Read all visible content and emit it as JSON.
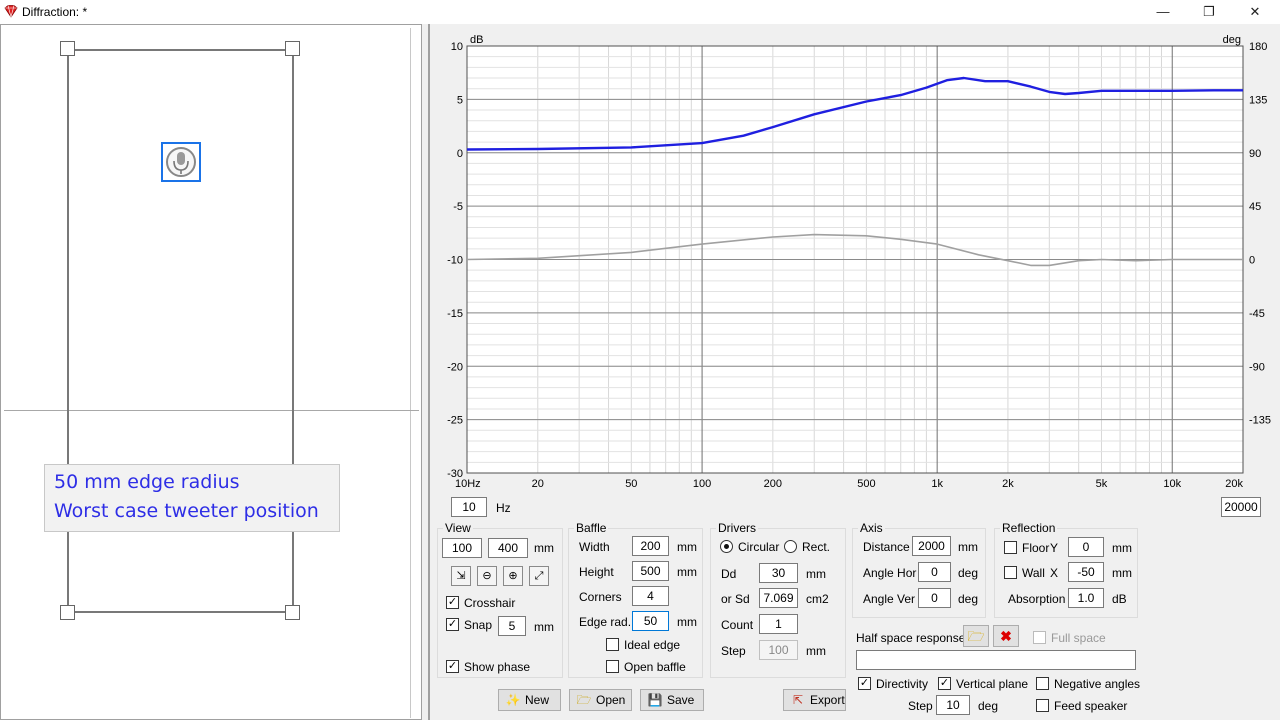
{
  "window": {
    "title": "Diffraction: *",
    "minimize": "—",
    "restore": "❐",
    "close": "✕"
  },
  "callout": {
    "line1": "50 mm edge radius",
    "line2": "Worst case tweeter position"
  },
  "chart_data": {
    "type": "line",
    "xscale": "log",
    "xlim": [
      10,
      20000
    ],
    "ylim": [
      -30,
      10
    ],
    "y2lim": [
      -180,
      180
    ],
    "left_unit": "dB",
    "right_unit": "deg",
    "x_tick_labels": [
      "10Hz",
      "20",
      "50",
      "100",
      "200",
      "500",
      "1k",
      "2k",
      "5k",
      "10k",
      "20k"
    ],
    "x_tick_values": [
      10,
      20,
      50,
      100,
      200,
      500,
      1000,
      2000,
      5000,
      10000,
      20000
    ],
    "y_ticks": [
      10,
      5,
      0,
      -5,
      -10,
      -15,
      -20,
      -25,
      -30
    ],
    "y2_ticks": [
      180,
      135,
      90,
      45,
      0,
      -45,
      -90,
      -135
    ],
    "grid": true,
    "series": [
      {
        "axis": "left",
        "color": "#1f1fe0",
        "x": [
          10,
          20,
          50,
          100,
          150,
          200,
          300,
          500,
          700,
          900,
          1100,
          1300,
          1600,
          2000,
          2500,
          3000,
          3500,
          4000,
          5000,
          6000,
          8000,
          10000,
          15000,
          20000
        ],
        "y": [
          0.3,
          0.35,
          0.5,
          0.9,
          1.6,
          2.4,
          3.6,
          4.8,
          5.4,
          6.1,
          6.8,
          7.0,
          6.7,
          6.7,
          6.2,
          5.7,
          5.5,
          5.6,
          5.8,
          5.8,
          5.8,
          5.8,
          5.85,
          5.85
        ]
      },
      {
        "axis": "right",
        "color": "#a0a0a0",
        "x": [
          10,
          20,
          50,
          100,
          200,
          300,
          500,
          700,
          1000,
          1500,
          2000,
          2500,
          3000,
          4000,
          5000,
          7000,
          10000,
          20000
        ],
        "y": [
          0,
          1,
          6,
          13,
          19,
          21,
          20,
          17,
          13,
          4,
          -1,
          -5,
          -5,
          -1,
          0,
          -1,
          0,
          0
        ]
      }
    ]
  },
  "freq_range": {
    "min": "10",
    "unit": "Hz",
    "max": "20000"
  },
  "view": {
    "title": "View",
    "zoom_min": "100",
    "zoom_max": "400",
    "unit": "mm",
    "crosshair_label": "Crosshair",
    "crosshair_checked": true,
    "snap_label": "Snap",
    "snap_checked": true,
    "snap_value": "5",
    "snap_unit": "mm",
    "show_phase_label": "Show phase",
    "show_phase_checked": true
  },
  "baffle": {
    "title": "Baffle",
    "width_label": "Width",
    "width": "200",
    "width_unit": "mm",
    "height_label": "Height",
    "height": "500",
    "height_unit": "mm",
    "corners_label": "Corners",
    "corners": "4",
    "edge_rad_label": "Edge rad.",
    "edge_rad": "50",
    "edge_rad_unit": "mm",
    "ideal_edge_label": "Ideal edge",
    "ideal_edge_checked": false,
    "open_baffle_label": "Open baffle",
    "open_baffle_checked": false
  },
  "drivers": {
    "title": "Drivers",
    "circular_label": "Circular",
    "circular_selected": true,
    "rect_label": "Rect.",
    "dd_label": "Dd",
    "dd": "30",
    "dd_unit": "mm",
    "sd_label": "or Sd",
    "sd": "7.069",
    "sd_unit": "cm2",
    "count_label": "Count",
    "count": "1",
    "step_label": "Step",
    "step": "100",
    "step_unit": "mm"
  },
  "axis": {
    "title": "Axis",
    "distance_label": "Distance",
    "distance": "2000",
    "distance_unit": "mm",
    "angle_hor_label": "Angle Hor",
    "angle_hor": "0",
    "angle_hor_unit": "deg",
    "angle_ver_label": "Angle Ver",
    "angle_ver": "0",
    "angle_ver_unit": "deg"
  },
  "reflection": {
    "title": "Reflection",
    "floor_label": "Floor",
    "floor_axis": "Y",
    "floor_value": "0",
    "floor_unit": "mm",
    "floor_checked": false,
    "wall_label": "Wall",
    "wall_axis": "X",
    "wall_value": "-50",
    "wall_unit": "mm",
    "wall_checked": false,
    "absorption_label": "Absorption",
    "absorption": "1.0",
    "absorption_unit": "dB"
  },
  "half_space": {
    "label": "Half space response",
    "full_space_label": "Full space",
    "full_space_checked": false,
    "file": ""
  },
  "options": {
    "directivity_label": "Directivity",
    "directivity_checked": true,
    "vertical_plane_label": "Vertical plane",
    "vertical_plane_checked": true,
    "negative_angles_label": "Negative angles",
    "negative_angles_checked": false,
    "feed_speaker_label": "Feed speaker",
    "feed_speaker_checked": false,
    "step_label": "Step",
    "step": "10",
    "step_unit": "deg"
  },
  "buttons": {
    "new": "New",
    "open": "Open",
    "save": "Save",
    "export": "Export"
  },
  "check_mark": "✓"
}
